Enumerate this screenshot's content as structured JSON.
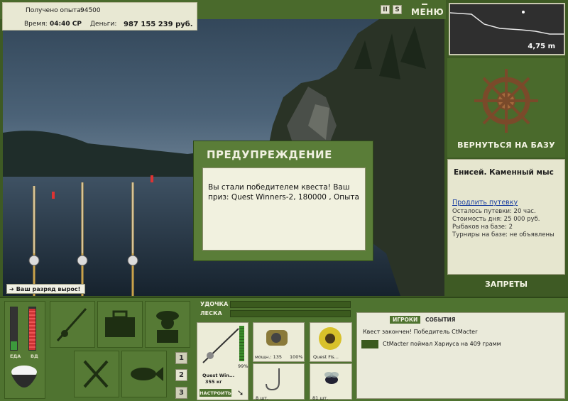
{
  "stats": {
    "exp_label": "Получено опыта:",
    "exp_value": "94500",
    "time_label": "Время:",
    "time_value": "04:40 СР",
    "money_label": "Деньги:",
    "money_value": "987 155 239 руб."
  },
  "top_icons": {
    "pause": "II",
    "sound": "S",
    "menu": "МЕНЮ"
  },
  "depth": {
    "value": "4,75 m"
  },
  "right_panel": {
    "return_base": "ВЕРНУТЬСЯ НА БАЗУ",
    "location_title": "Енисей. Каменный мыс",
    "extend_link": "Продлить путевку",
    "info": [
      "Осталось путевки: 20 час.",
      "Стоимость дня: 25 000 руб.",
      "Рыбаков на базе: 2",
      "Турниры на базе: не объявлены"
    ],
    "bans": "ЗАПРЕТЫ"
  },
  "dialog": {
    "title": "ПРЕДУПРЕЖДЕНИЕ",
    "body": "Вы стали победителем квеста! Ваш приз: Quest Winners-2, 180000 , Опыта"
  },
  "toast": "Ваш разряд вырос!",
  "meters": {
    "food_label": "ЕДА",
    "vd_label": "ВД"
  },
  "tackle": {
    "rod_label": "УДОЧКА",
    "line_label": "ЛЕСКА",
    "rod_name": "Quest Win...",
    "rod_weight": "355 кг",
    "rod_condition": "99%",
    "setup_button": "НАСТРОИТЬ",
    "reel_caption": "мощн.: 135",
    "reel_percent": "100%",
    "line_caption": "Quest Fis...",
    "hook_caption": "8 шт.",
    "bait_caption": "81 шт."
  },
  "numbers": [
    "1",
    "2",
    "3"
  ],
  "events": {
    "tab_players": "ИГРОКИ",
    "tab_events": "СОБЫТИЯ",
    "lines": [
      "Квест закончен! Победитель CtMacter",
      "CtMacter поймал Хариуса на 409 грамм"
    ]
  },
  "colors": {
    "panel_green": "#4f7330",
    "dark_green": "#3b5a1e",
    "cream": "#e6e6cf",
    "link_blue": "#1b3fa0"
  }
}
